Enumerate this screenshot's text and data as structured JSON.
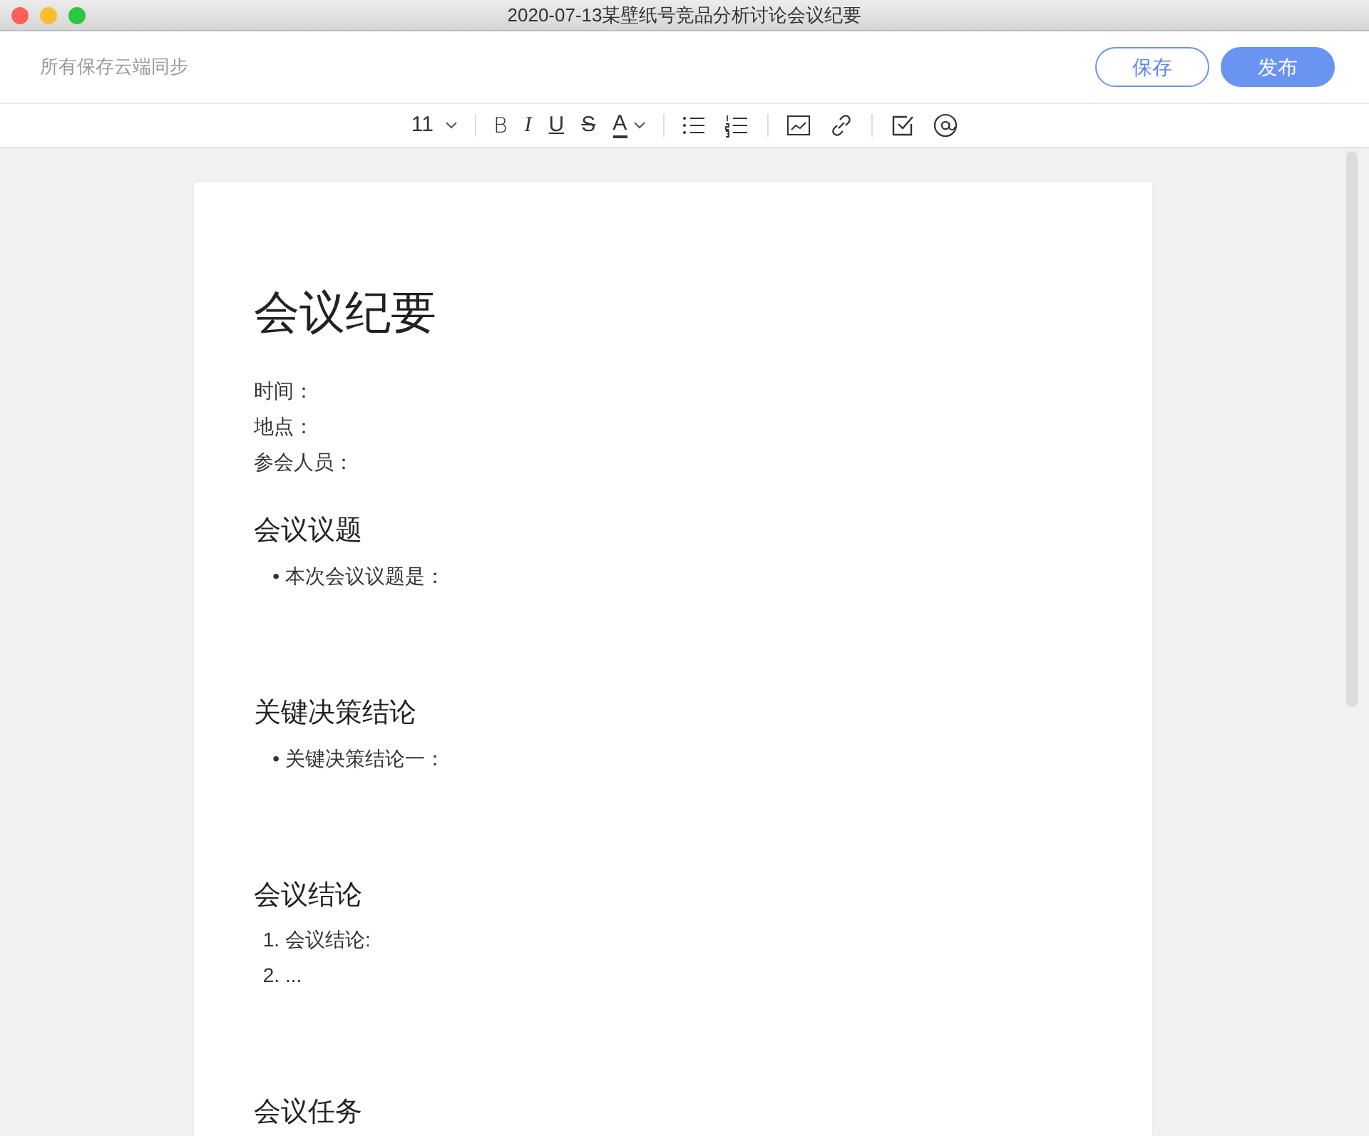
{
  "window": {
    "title": "2020-07-13某壁纸号竞品分析讨论会议纪要"
  },
  "header": {
    "sync_status": "所有保存云端同步",
    "buttons": [
      {
        "label": "保存",
        "kind": "outline"
      },
      {
        "label": "发布",
        "kind": "primary"
      }
    ]
  },
  "toolbar": {
    "groups": [
      [
        {
          "kind": "dropdown",
          "label": "11"
        }
      ],
      [
        {
          "kind": "glyph",
          "label": "B"
        },
        {
          "kind": "glyph",
          "label": "I"
        },
        {
          "kind": "glyph",
          "label": "U"
        },
        {
          "kind": "glyph",
          "label": "S"
        },
        {
          "kind": "color",
          "label": "A"
        }
      ],
      [
        {
          "kind": "icon"
        },
        {
          "kind": "icon"
        }
      ],
      [
        {
          "kind": "icon"
        },
        {
          "kind": "icon"
        }
      ],
      [
        {
          "kind": "icon"
        },
        {
          "kind": "icon"
        }
      ]
    ]
  },
  "document": {
    "blocks": [
      {
        "kind": "title",
        "text": "会议纪要"
      },
      {
        "kind": "paragraph",
        "text": "时间："
      },
      {
        "kind": "paragraph",
        "text": "地点："
      },
      {
        "kind": "paragraph",
        "text": "参会人员："
      },
      {
        "kind": "heading",
        "text": "会议议题"
      },
      {
        "kind": "list",
        "items": [
          {
            "marker": "•",
            "text": "本次会议议题是："
          }
        ]
      },
      {
        "kind": "heading",
        "text": "关键决策结论"
      },
      {
        "kind": "list",
        "items": [
          {
            "marker": "•",
            "text": "关键决策结论一："
          }
        ]
      },
      {
        "kind": "heading",
        "text": "会议结论"
      },
      {
        "kind": "list",
        "items": [
          {
            "marker": "1.",
            "text": "会议结论:"
          },
          {
            "marker": "2.",
            "text": "..."
          }
        ]
      },
      {
        "kind": "heading",
        "text": "会议任务"
      }
    ]
  }
}
